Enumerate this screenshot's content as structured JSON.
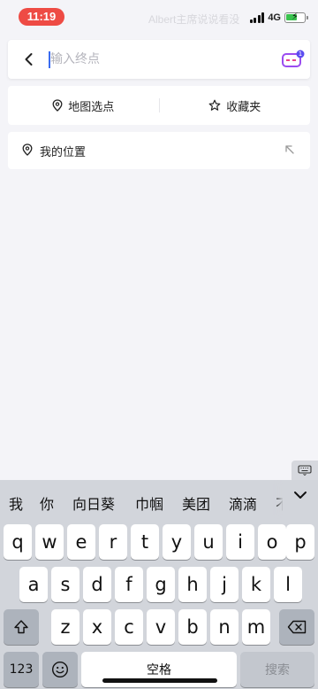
{
  "status_bar": {
    "time": "11:19",
    "network": "4G",
    "watermark": "Albert主席说说看没"
  },
  "search": {
    "placeholder": "输入终点",
    "value": "",
    "badge": "1"
  },
  "actions": {
    "map_pick": "地图选点",
    "favorites": "收藏夹"
  },
  "my_location": {
    "label": "我的位置"
  },
  "candidates": [
    "我",
    "你",
    "向日葵",
    "巾帼",
    "美团",
    "滴滴",
    "不"
  ],
  "keyboard": {
    "row1": [
      "q",
      "w",
      "e",
      "r",
      "t",
      "y",
      "u",
      "i",
      "o",
      "p"
    ],
    "row2": [
      "a",
      "s",
      "d",
      "f",
      "g",
      "h",
      "j",
      "k",
      "l"
    ],
    "row3": [
      "z",
      "x",
      "c",
      "v",
      "b",
      "n",
      "m"
    ],
    "numbers_key": "123",
    "space_label": "空格",
    "search_label": "搜索"
  },
  "colors": {
    "time_pill": "#ee4b44",
    "caret": "#3b6cf0",
    "battery": "#39c24e"
  }
}
